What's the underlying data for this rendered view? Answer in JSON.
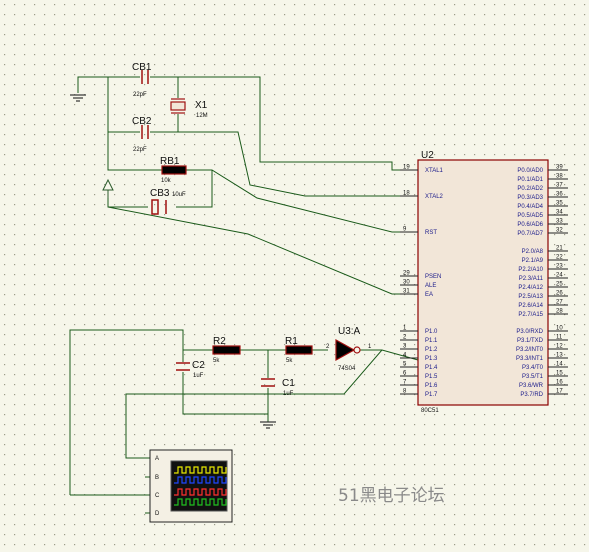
{
  "components": {
    "cb1": {
      "ref": "CB1",
      "value": "22pF"
    },
    "cb2": {
      "ref": "CB2",
      "value": "22pF"
    },
    "x1": {
      "ref": "X1",
      "value": "12M"
    },
    "rb1": {
      "ref": "RB1",
      "value": "10k"
    },
    "cb3": {
      "ref": "CB3",
      "value": "10uF"
    },
    "r1": {
      "ref": "R1",
      "value": "5k"
    },
    "r2": {
      "ref": "R2",
      "value": "5k"
    },
    "c1": {
      "ref": "C1",
      "value": "1uF"
    },
    "c2": {
      "ref": "C2",
      "value": "1uF"
    },
    "u3": {
      "ref": "U3:A",
      "part": "74S04",
      "pin_in": "2",
      "pin_out": "1"
    },
    "u2": {
      "ref": "U2",
      "part": "80C51"
    }
  },
  "u2_left_pins": [
    {
      "num": "19",
      "name": "XTAL1"
    },
    {
      "num": "18",
      "name": "XTAL2"
    },
    {
      "num": "9",
      "name": "RST"
    },
    {
      "num": "29",
      "name": "PSEN"
    },
    {
      "num": "30",
      "name": "ALE"
    },
    {
      "num": "31",
      "name": "EA"
    },
    {
      "num": "1",
      "name": "P1.0"
    },
    {
      "num": "2",
      "name": "P1.1"
    },
    {
      "num": "3",
      "name": "P1.2"
    },
    {
      "num": "4",
      "name": "P1.3"
    },
    {
      "num": "5",
      "name": "P1.4"
    },
    {
      "num": "6",
      "name": "P1.5"
    },
    {
      "num": "7",
      "name": "P1.6"
    },
    {
      "num": "8",
      "name": "P1.7"
    }
  ],
  "u2_right_pins": [
    {
      "num": "39",
      "name": "P0.0/AD0"
    },
    {
      "num": "38",
      "name": "P0.1/AD1"
    },
    {
      "num": "37",
      "name": "P0.2/AD2"
    },
    {
      "num": "36",
      "name": "P0.3/AD3"
    },
    {
      "num": "35",
      "name": "P0.4/AD4"
    },
    {
      "num": "34",
      "name": "P0.5/AD5"
    },
    {
      "num": "33",
      "name": "P0.6/AD6"
    },
    {
      "num": "32",
      "name": "P0.7/AD7"
    },
    {
      "num": "21",
      "name": "P2.0/A8"
    },
    {
      "num": "22",
      "name": "P2.1/A9"
    },
    {
      "num": "23",
      "name": "P2.2/A10"
    },
    {
      "num": "24",
      "name": "P2.3/A11"
    },
    {
      "num": "25",
      "name": "P2.4/A12"
    },
    {
      "num": "26",
      "name": "P2.5/A13"
    },
    {
      "num": "27",
      "name": "P2.6/A14"
    },
    {
      "num": "28",
      "name": "P2.7/A15"
    },
    {
      "num": "10",
      "name": "P3.0/RXD"
    },
    {
      "num": "11",
      "name": "P3.1/TXD"
    },
    {
      "num": "12",
      "name": "P3.2/INT0"
    },
    {
      "num": "13",
      "name": "P3.3/INT1"
    },
    {
      "num": "14",
      "name": "P3.4/T0"
    },
    {
      "num": "15",
      "name": "P3.5/T1"
    },
    {
      "num": "16",
      "name": "P3.6/WR"
    },
    {
      "num": "17",
      "name": "P3.7/RD"
    }
  ],
  "oscilloscope": {
    "channels": [
      "A",
      "B",
      "C",
      "D"
    ]
  },
  "watermark": "51黑电子论坛",
  "colors": {
    "background": "#f6f6ea",
    "grid_dot": "#9a9a88",
    "wire": "#1a5a1a",
    "component": "#a01010",
    "component_fill": "#f2e6d8",
    "chip_outline": "#8b0000",
    "scope_body": "#f4f0e4",
    "scope_screen": "#101010",
    "trace_a": "#e8e800",
    "trace_b": "#1e46ff",
    "trace_c": "#ff3030",
    "trace_d": "#20c020"
  }
}
